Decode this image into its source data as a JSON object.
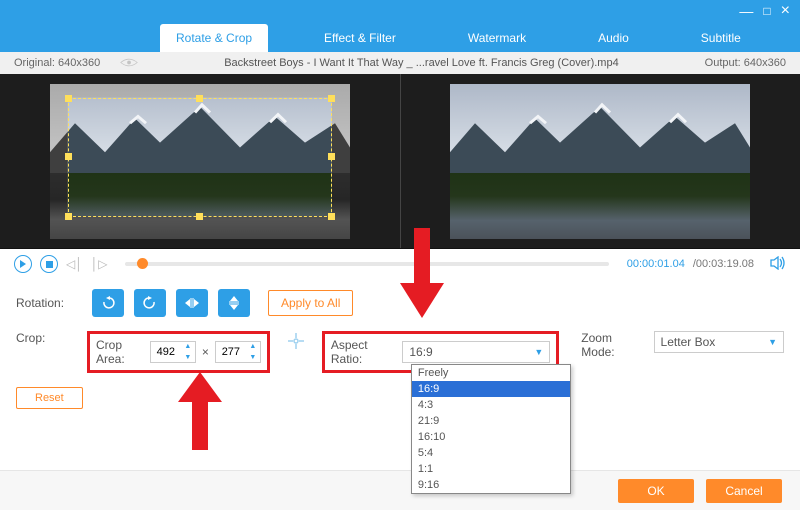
{
  "titlebar": {
    "minimize": "—",
    "maximize": "□",
    "close": "×"
  },
  "tabs": {
    "active": "Rotate & Crop",
    "items": [
      "Rotate & Crop",
      "Effect & Filter",
      "Watermark",
      "Audio",
      "Subtitle"
    ]
  },
  "info": {
    "original": "Original: 640x360",
    "filename": "Backstreet Boys - I Want It That Way _ ...ravel Love ft. Francis Greg (Cover).mp4",
    "output": "Output: 640x360"
  },
  "playback": {
    "current": "00:00:01.04",
    "total": "/00:03:19.08"
  },
  "rotation": {
    "label": "Rotation:",
    "apply_all": "Apply to All"
  },
  "crop": {
    "label": "Crop:",
    "area_label": "Crop Area:",
    "width": "492",
    "x": "×",
    "height": "277",
    "reset": "Reset"
  },
  "aspect": {
    "label": "Aspect Ratio:",
    "value": "16:9",
    "options": [
      "Freely",
      "16:9",
      "4:3",
      "21:9",
      "16:10",
      "5:4",
      "1:1",
      "9:16"
    ]
  },
  "zoom": {
    "label": "Zoom Mode:",
    "value": "Letter Box"
  },
  "footer": {
    "ok": "OK",
    "cancel": "Cancel"
  }
}
